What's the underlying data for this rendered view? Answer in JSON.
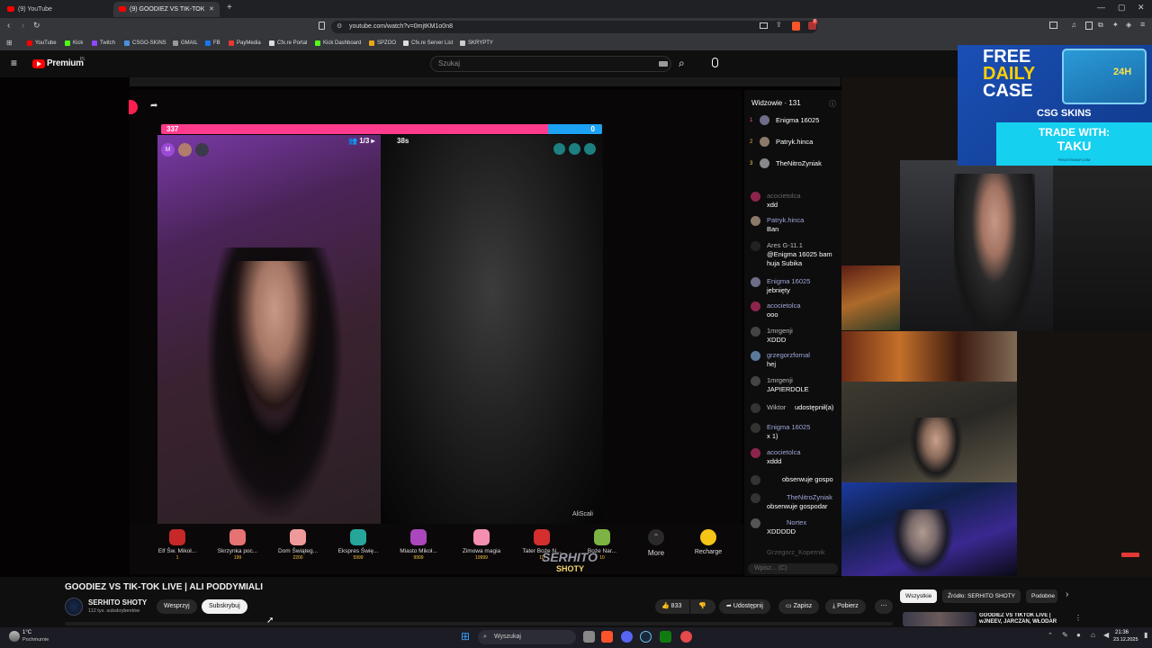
{
  "browser": {
    "tabs": [
      {
        "label": "(9) YouTube"
      },
      {
        "label": "(9) GOODIEZ VS TIK-TOK LIVE"
      }
    ],
    "url": "youtube.com/watch?v=0mjtKM1o0n8",
    "notification_badge": "8",
    "bookmarks": [
      {
        "label": "YouTube",
        "color": "#ff0000"
      },
      {
        "label": "Kick",
        "color": "#53fc18"
      },
      {
        "label": "Twitch",
        "color": "#9146ff"
      },
      {
        "label": "CSGO-SKINS",
        "color": "#4a90e2"
      },
      {
        "label": "GMAIL",
        "color": "#999999"
      },
      {
        "label": "FB",
        "color": "#1877f2"
      },
      {
        "label": "PayMedia",
        "color": "#e53935"
      },
      {
        "label": "Cfx.re Portal",
        "color": "#dddddd"
      },
      {
        "label": "Kick Dashboard",
        "color": "#53fc18"
      },
      {
        "label": "SPZOO",
        "color": "#e6a817"
      },
      {
        "label": "Cfx.re Server List",
        "color": "#dddddd"
      },
      {
        "label": "SKRYPTY",
        "color": "#cccccc"
      }
    ]
  },
  "youtube": {
    "logo_text": "Premium",
    "logo_region": "PL",
    "search_placeholder": "Szukaj"
  },
  "tiktok": {
    "left_score": "337",
    "right_score": "0",
    "round": "1/3",
    "timer": "38s",
    "right_username": "AliScali",
    "watermark": "SERHITO",
    "watermark_sub": "SHOTY",
    "gifts": [
      {
        "label": "Elf Św. Mikoł...",
        "cost": "1",
        "color": "#c62828"
      },
      {
        "label": "Skrzynka poc...",
        "cost": "199",
        "color": "#e57373"
      },
      {
        "label": "Dom Świąteg...",
        "cost": "2200",
        "color": "#ef9a9a"
      },
      {
        "label": "Ekspres Świę...",
        "cost": "5999",
        "color": "#26a69a"
      },
      {
        "label": "Miasto Mikoł...",
        "cost": "9999",
        "color": "#ab47bc"
      },
      {
        "label": "Zimowa magia",
        "cost": "19999",
        "color": "#f48fb1"
      },
      {
        "label": "Tater Boże N...",
        "cost": "10",
        "color": "#d32f2f"
      },
      {
        "label": "Boże Nar...",
        "cost": "10",
        "color": "#7cb342"
      }
    ],
    "more_label": "More",
    "recharge_label": "Recharge"
  },
  "chat": {
    "viewers_label": "Widzowie · 131",
    "top_viewers": [
      {
        "rank": "1",
        "name": "Enigma 16025"
      },
      {
        "rank": "2",
        "name": "Patryk.hinca"
      },
      {
        "rank": "3",
        "name": "TheNitroZyniak"
      }
    ],
    "messages": [
      {
        "name": "acocietolca",
        "text": "xdd"
      },
      {
        "name": "Patryk.hinca",
        "text": "Ban"
      },
      {
        "name": "Ares G-11.1",
        "text": "@Enigma 16025 bam huja Subika"
      },
      {
        "name": "Enigma 16025",
        "text": "jebnięty"
      },
      {
        "name": "acocietolca",
        "text": "ooo"
      },
      {
        "name": "1mrgenji",
        "text": "XDDD"
      },
      {
        "name": "grzegorzfornal",
        "text": "hej"
      },
      {
        "name": "1mrgenji",
        "text": "JAPIERDOLE"
      },
      {
        "name": "Wiktor",
        "text": "udostępnił(a)"
      },
      {
        "name": "Enigma 16025",
        "text": "x 1)"
      },
      {
        "name": "acocietolca",
        "text": "xddd"
      },
      {
        "name": "",
        "text": "obserwuje gospo"
      },
      {
        "name": "TheNitroZyniak",
        "text": "obserwuje gospodar"
      },
      {
        "name": "Nortex",
        "text": "XDDDDD"
      },
      {
        "name": "Grzegorz_Kopernik",
        "text": ""
      }
    ],
    "input_placeholder": "Wpisz... (C)"
  },
  "ad": {
    "line1": "FREE",
    "line2": "DAILY",
    "line3": "CASE",
    "badge": "24H",
    "brand": "CSG SKINS",
    "trade_line1": "TRADE WITH:",
    "trade_line2": "TAKU",
    "site": "PIRATESWAP.COM"
  },
  "video": {
    "title": "GOODIEZ VS TIK-TOK LIVE | ALI PODDYMIALI",
    "channel_name": "SERHITO SHOTY",
    "subscribers": "112 tys. subskrybentów",
    "support_label": "Wesprzyj",
    "subscribe_label": "Subskrybuj",
    "likes": "833",
    "share_label": "Udostępnij",
    "save_label": "Zapisz",
    "download_label": "Pobierz",
    "chips": [
      "Wszystkie",
      "Źródło: SERHITO SHOTY",
      "Podobne"
    ],
    "recommended_title": "GOODIEZ VS TIKTOK LIVE | wJNEEV, JARCZAN, WŁODAR"
  },
  "taskbar": {
    "weather_temp": "1°C",
    "weather_desc": "Pochmurnie",
    "search_label": "Wyszukaj",
    "time": "21:36",
    "date": "23.12.2025"
  }
}
